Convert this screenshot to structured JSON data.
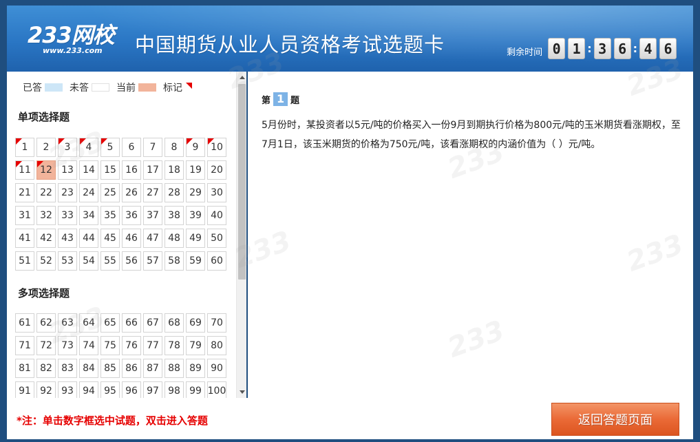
{
  "header": {
    "logo": "233网校",
    "logo_sub": "www.233.com",
    "title": "中国期货从业人员资格考试选题卡",
    "timer_label": "剩余时间",
    "timer_digits": [
      "0",
      "1",
      "3",
      "6",
      "4",
      "6"
    ],
    "timer_separators": [
      ":",
      ":"
    ]
  },
  "legend": {
    "answered": "已答",
    "unanswered": "未答",
    "current": "当前",
    "flagged": "标记"
  },
  "sections": [
    {
      "title": "单项选择题",
      "cells": [
        {
          "n": "1",
          "flag": true
        },
        {
          "n": "2"
        },
        {
          "n": "3",
          "flag": true
        },
        {
          "n": "4",
          "flag": true
        },
        {
          "n": "5",
          "flag": true
        },
        {
          "n": "6"
        },
        {
          "n": "7"
        },
        {
          "n": "8"
        },
        {
          "n": "9",
          "flag": true
        },
        {
          "n": "10",
          "flag": true
        },
        {
          "n": "11",
          "flag": true
        },
        {
          "n": "12",
          "flag": true,
          "current": true
        },
        {
          "n": "13"
        },
        {
          "n": "14"
        },
        {
          "n": "15"
        },
        {
          "n": "16"
        },
        {
          "n": "17"
        },
        {
          "n": "18"
        },
        {
          "n": "19"
        },
        {
          "n": "20"
        },
        {
          "n": "21"
        },
        {
          "n": "22"
        },
        {
          "n": "23"
        },
        {
          "n": "24"
        },
        {
          "n": "25"
        },
        {
          "n": "26"
        },
        {
          "n": "27"
        },
        {
          "n": "28"
        },
        {
          "n": "29"
        },
        {
          "n": "30"
        },
        {
          "n": "31"
        },
        {
          "n": "32"
        },
        {
          "n": "33"
        },
        {
          "n": "34"
        },
        {
          "n": "35"
        },
        {
          "n": "36"
        },
        {
          "n": "37"
        },
        {
          "n": "38"
        },
        {
          "n": "39"
        },
        {
          "n": "40"
        },
        {
          "n": "41"
        },
        {
          "n": "42"
        },
        {
          "n": "43"
        },
        {
          "n": "44"
        },
        {
          "n": "45"
        },
        {
          "n": "46"
        },
        {
          "n": "47"
        },
        {
          "n": "48"
        },
        {
          "n": "49"
        },
        {
          "n": "50"
        },
        {
          "n": "51"
        },
        {
          "n": "52"
        },
        {
          "n": "53"
        },
        {
          "n": "54"
        },
        {
          "n": "55"
        },
        {
          "n": "56"
        },
        {
          "n": "57"
        },
        {
          "n": "58"
        },
        {
          "n": "59"
        },
        {
          "n": "60"
        }
      ]
    },
    {
      "title": "多项选择题",
      "cells": [
        {
          "n": "61"
        },
        {
          "n": "62"
        },
        {
          "n": "63"
        },
        {
          "n": "64"
        },
        {
          "n": "65"
        },
        {
          "n": "66"
        },
        {
          "n": "67"
        },
        {
          "n": "68"
        },
        {
          "n": "69"
        },
        {
          "n": "70"
        },
        {
          "n": "71"
        },
        {
          "n": "72"
        },
        {
          "n": "73"
        },
        {
          "n": "74"
        },
        {
          "n": "75"
        },
        {
          "n": "76"
        },
        {
          "n": "77"
        },
        {
          "n": "78"
        },
        {
          "n": "79"
        },
        {
          "n": "80"
        },
        {
          "n": "81"
        },
        {
          "n": "82"
        },
        {
          "n": "83"
        },
        {
          "n": "84"
        },
        {
          "n": "85"
        },
        {
          "n": "86"
        },
        {
          "n": "87"
        },
        {
          "n": "88"
        },
        {
          "n": "89"
        },
        {
          "n": "90"
        },
        {
          "n": "91"
        },
        {
          "n": "92"
        },
        {
          "n": "93"
        },
        {
          "n": "94"
        },
        {
          "n": "95"
        },
        {
          "n": "96"
        },
        {
          "n": "97"
        },
        {
          "n": "98"
        },
        {
          "n": "99"
        },
        {
          "n": "100"
        }
      ]
    }
  ],
  "question": {
    "prefix": "第",
    "number": "1",
    "suffix": "题",
    "text": "5月份时，某投资者以5元/吨的价格买入一份9月到期执行价格为800元/吨的玉米期货看涨期权，至7月1日，该玉米期货的价格为750元/吨，该看涨期权的内涵价值为（ ）元/吨。"
  },
  "footer": {
    "note": "*注：单击数字框选中试题，双击进入答题",
    "return_button": "返回答题页面"
  },
  "colors": {
    "header_blue": "#2a76c4",
    "answered": "#cde6f7",
    "current": "#f2b49b",
    "flag": "#e60000",
    "button_orange": "#ea6a37",
    "note_red": "#e60000"
  }
}
